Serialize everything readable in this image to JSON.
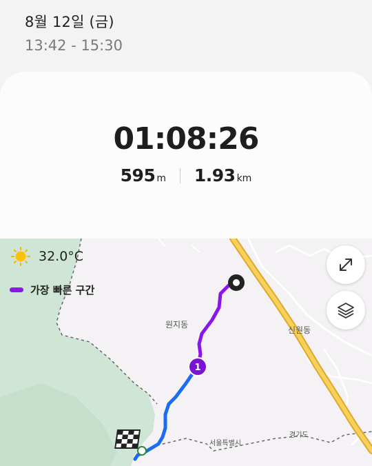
{
  "header": {
    "date": "8월 12일 (금)",
    "time_range": "13:42 - 15:30"
  },
  "summary": {
    "duration": "01:08:26",
    "elevation_value": "595",
    "elevation_unit": "m",
    "distance_value": "1.93",
    "distance_unit": "km"
  },
  "map": {
    "weather": {
      "icon": "sun-icon",
      "temperature": "32.0°C"
    },
    "legend": {
      "label": "가장 빠른 구간",
      "color": "#8a17e8"
    },
    "place_labels": {
      "wonji": "원지동",
      "sinwon": "신원동",
      "seoul": "서울특별시",
      "gyeonggi": "경기도"
    },
    "segment_marker": "1",
    "buttons": {
      "expand": "expand-icon",
      "layers": "layers-icon"
    },
    "colors": {
      "route": "#1a6df2",
      "fastest_segment": "#8a17e8",
      "highway": "#f6c43a",
      "park": "#cfe6d6"
    }
  }
}
